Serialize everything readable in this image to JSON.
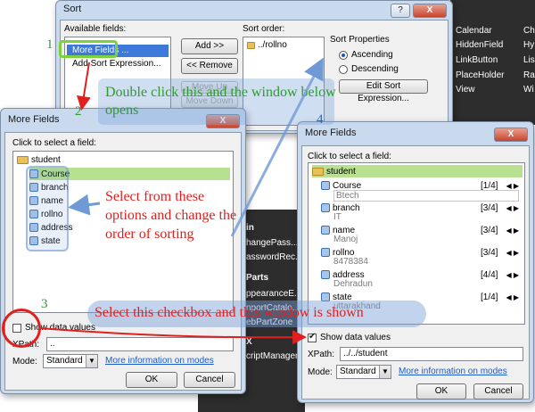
{
  "sort_dialog": {
    "title": "Sort",
    "help_btn": "?",
    "close_btn": "X",
    "available_label": "Available fields:",
    "available_items": [
      "More Fields ...",
      "Add Sort Expression..."
    ],
    "add_btn": "Add >>",
    "remove_btn": "<< Remove",
    "move_up_btn": "Move Up",
    "move_down_btn": "Move Down",
    "sort_order_label": "Sort order:",
    "sort_order_item": "../rollno",
    "sort_props_label": "Sort Properties",
    "ascending": "Ascending",
    "descending": "Descending",
    "edit_expr_btn": "Edit Sort Expression..."
  },
  "toolbox": {
    "items": [
      "Calendar",
      "HiddenField",
      "LinkButton",
      "PlaceHolder",
      "View"
    ],
    "items_right": [
      "Ch",
      "Hy",
      "Lis",
      "Ra",
      "Wi"
    ]
  },
  "middle_toolbox": {
    "items": [
      "in",
      "hangePass...",
      "asswordRec...",
      "Parts",
      "ppearanceE...",
      "nportCatalo...",
      "ebPartZone",
      "X",
      "criptManager"
    ]
  },
  "more_fields_left": {
    "title": "More Fields",
    "close_btn": "X",
    "instruction": "Click to select a field:",
    "root": "student",
    "fields": [
      "Course",
      "branch",
      "name",
      "rollno",
      "address",
      "state"
    ],
    "show_label": "Show data values",
    "xpath_label": "XPath:",
    "xpath_value": "..",
    "mode_label": "Mode:",
    "mode_value": "Standard",
    "more_info_link": "More information on modes",
    "ok_btn": "OK",
    "cancel_btn": "Cancel"
  },
  "more_fields_right": {
    "title": "More Fields",
    "close_btn": "X",
    "instruction": "Click to select a field:",
    "root": "student",
    "fields": [
      {
        "name": "Course",
        "count": "[1/4]",
        "value": "Btech"
      },
      {
        "name": "branch",
        "count": "[3/4]",
        "value": "IT"
      },
      {
        "name": "name",
        "count": "[3/4]",
        "value": "Manoj"
      },
      {
        "name": "rollno",
        "count": "[3/4]",
        "value": "8478384"
      },
      {
        "name": "address",
        "count": "[4/4]",
        "value": "Dehradun"
      },
      {
        "name": "state",
        "count": "[1/4]",
        "value": "uttarakhand"
      }
    ],
    "show_label": "Show data values",
    "xpath_label": "XPath:",
    "xpath_value": "../../student",
    "mode_label": "Mode:",
    "mode_value": "Standard",
    "more_info_link": "More information on modes",
    "ok_btn": "OK",
    "cancel_btn": "Cancel"
  },
  "annotations": {
    "n1": "1",
    "n2": "2",
    "n3": "3",
    "n4": "4",
    "double_click": "Double click this and the window below opens",
    "select_options": "Select from these options and change the order of sorting",
    "select_checkbox": "Select this checkbox and this window is shown"
  },
  "colors": {
    "green_annotation": "#2e9b2e",
    "red_annotation": "#e0201f",
    "blue_highlight": "#6f9ad6"
  }
}
